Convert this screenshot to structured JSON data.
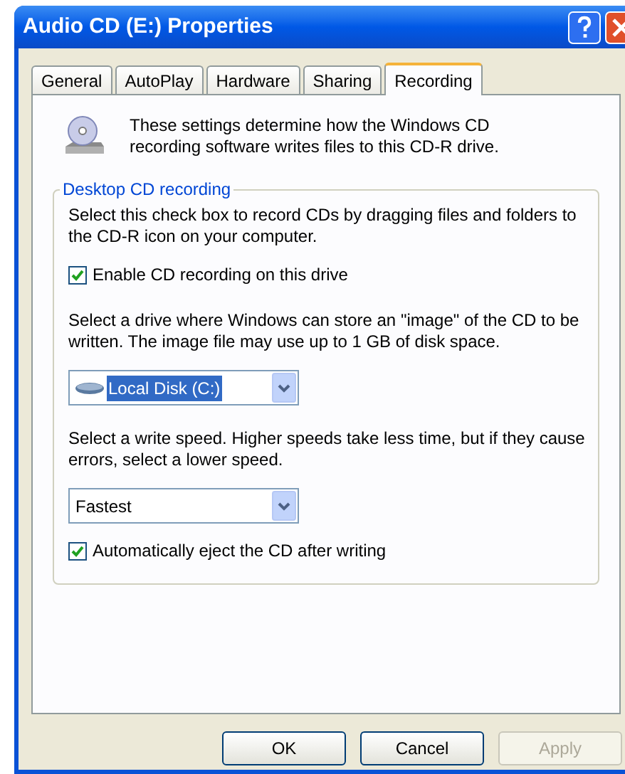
{
  "window": {
    "title": "Audio CD (E:) Properties"
  },
  "tabs": [
    {
      "label": "General",
      "selected": false
    },
    {
      "label": "AutoPlay",
      "selected": false
    },
    {
      "label": "Hardware",
      "selected": false
    },
    {
      "label": "Sharing",
      "selected": false
    },
    {
      "label": "Recording",
      "selected": true
    }
  ],
  "intro": "These settings determine how the Windows CD recording software writes files to this CD-R drive.",
  "group": {
    "title": "Desktop CD recording",
    "items": [
      {
        "kind": "text",
        "text": "Select this check box to record CDs by dragging files and folders to the CD-R icon on your computer."
      },
      {
        "kind": "checkbox",
        "label": "Enable CD recording on this drive",
        "checked": true
      },
      {
        "kind": "text",
        "text": "Select a drive where Windows can store an \"image\" of the CD to be written. The image file may use up to 1 GB of disk space."
      },
      {
        "kind": "dropdown",
        "value": "Local Disk (C:)",
        "icon": true,
        "highlighted": true
      },
      {
        "kind": "text",
        "text": "Select a write speed.  Higher speeds take less time, but if they cause errors, select a lower speed."
      },
      {
        "kind": "dropdown",
        "value": "Fastest",
        "icon": false,
        "highlighted": false
      },
      {
        "kind": "checkbox",
        "label": "Automatically eject the CD after writing",
        "checked": true
      }
    ]
  },
  "buttons": [
    {
      "label": "OK",
      "disabled": false
    },
    {
      "label": "Cancel",
      "disabled": false
    },
    {
      "label": "Apply",
      "disabled": true
    }
  ]
}
